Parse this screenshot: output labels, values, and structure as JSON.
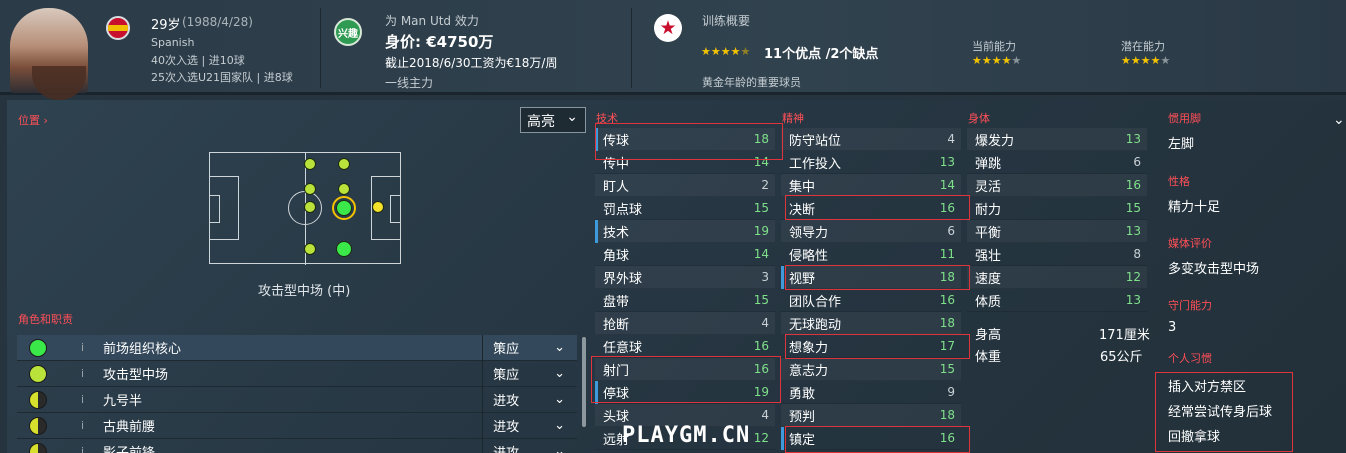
{
  "header": {
    "age": "29岁",
    "dob": "(1988/4/28)",
    "nationality": "Spanish",
    "caps_line": "40次入选 | 进10球",
    "u21_line": "25次入选U21国家队 | 进8球",
    "club_badge": "兴趣",
    "club_line": "为 Man Utd 效力",
    "value": "身价: €4750万",
    "contract": "截止2018/6/30工资为€18万/周",
    "role": "一线主力",
    "training_title": "训练概要",
    "training_stars": "★★★★",
    "training_half": "★",
    "pros_cons": "11个优点 /2个缺点",
    "gold_age": "黄金年龄的重要球员",
    "current_label": "当前能力",
    "potential_label": "潜在能力",
    "current_stars": "★★★★",
    "potential_stars": "★★★★",
    "star_empty": "★"
  },
  "position": {
    "label": "位置 ›",
    "dropdown": "高亮",
    "chevron": "⌄",
    "name": "攻击型中场 (中)"
  },
  "roles": {
    "label": "角色和职责",
    "items": [
      {
        "name": "前场组织核心",
        "duty": "策应",
        "color": "#3ae84a"
      },
      {
        "name": "攻击型中场",
        "duty": "策应",
        "color": "#b9e23a"
      },
      {
        "name": "九号半",
        "duty": "进攻",
        "color": "#d7e02c"
      },
      {
        "name": "古典前腰",
        "duty": "进攻",
        "color": "#d7e02c"
      },
      {
        "name": "影子前锋",
        "duty": "进攻",
        "color": "#d7e02c"
      }
    ],
    "info": "i"
  },
  "technical": {
    "label": "技术",
    "items": [
      [
        "传球",
        "18"
      ],
      [
        "传中",
        "14"
      ],
      [
        "盯人",
        "2"
      ],
      [
        "罚点球",
        "15"
      ],
      [
        "技术",
        "19"
      ],
      [
        "角球",
        "14"
      ],
      [
        "界外球",
        "3"
      ],
      [
        "盘带",
        "15"
      ],
      [
        "抢断",
        "4"
      ],
      [
        "任意球",
        "16"
      ],
      [
        "射门",
        "16"
      ],
      [
        "停球",
        "19"
      ],
      [
        "头球",
        "4"
      ],
      [
        "远射",
        "12"
      ]
    ]
  },
  "mental": {
    "label": "精神",
    "items": [
      [
        "防守站位",
        "4"
      ],
      [
        "工作投入",
        "13"
      ],
      [
        "集中",
        "14"
      ],
      [
        "决断",
        "16"
      ],
      [
        "领导力",
        "6"
      ],
      [
        "侵略性",
        "11"
      ],
      [
        "视野",
        "18"
      ],
      [
        "团队合作",
        "16"
      ],
      [
        "无球跑动",
        "18"
      ],
      [
        "想象力",
        "17"
      ],
      [
        "意志力",
        "15"
      ],
      [
        "勇敢",
        "9"
      ],
      [
        "预判",
        "18"
      ],
      [
        "镇定",
        "16"
      ]
    ]
  },
  "physical": {
    "label": "身体",
    "items": [
      [
        "爆发力",
        "13"
      ],
      [
        "弹跳",
        "6"
      ],
      [
        "灵活",
        "16"
      ],
      [
        "耐力",
        "15"
      ],
      [
        "平衡",
        "13"
      ],
      [
        "强壮",
        "8"
      ],
      [
        "速度",
        "12"
      ],
      [
        "体质",
        "13"
      ]
    ],
    "height_label": "身高",
    "height": "171厘米",
    "weight_label": "体重",
    "weight": "65公斤"
  },
  "side": {
    "foot_label": "惯用脚",
    "foot": "左脚",
    "personality_label": "性格",
    "personality": "精力十足",
    "media_label": "媒体评价",
    "media": "多变攻击型中场",
    "gk_label": "守门能力",
    "gk": "3",
    "habits_label": "个人习惯",
    "habits": [
      "插入对方禁区",
      "经常尝试传身后球",
      "回撤拿球"
    ]
  },
  "watermark": "PLAYGM.CN"
}
